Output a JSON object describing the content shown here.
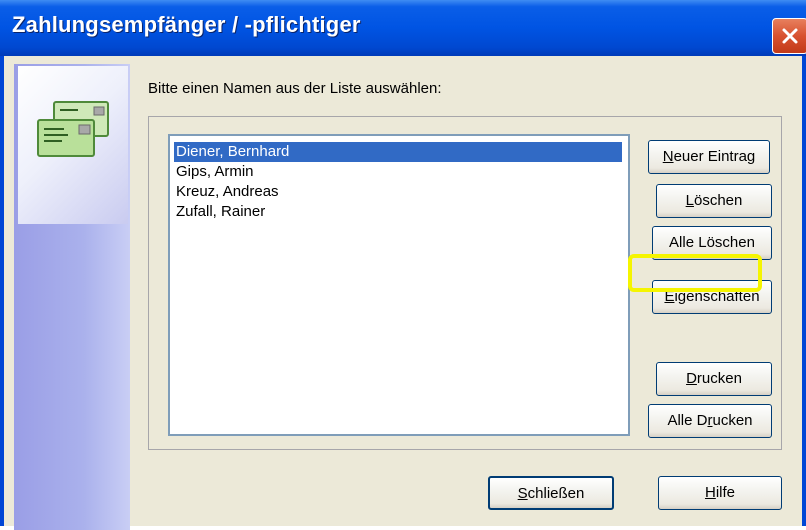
{
  "window": {
    "title": "Zahlungsempfänger / -pflichtiger",
    "close_icon": "close-icon"
  },
  "dialog": {
    "prompt": "Bitte einen Namen aus der Liste auswählen:",
    "side_icon": "envelope-stack-icon",
    "list": {
      "items": [
        "Diener, Bernhard",
        "Gips, Armin",
        "Kreuz, Andreas",
        "Zufall, Rainer"
      ],
      "selected_index": 0
    },
    "buttons": {
      "neuer_eintrag": {
        "mnemonic": "N",
        "rest": "euer Eintrag"
      },
      "loeschen": {
        "mnemonic": "L",
        "rest": "öschen"
      },
      "alle_loeschen": {
        "label": "Alle Löschen"
      },
      "eigenschaften": {
        "mnemonic": "E",
        "rest": "igenschaften"
      },
      "drucken": {
        "mnemonic": "D",
        "rest": "rucken"
      },
      "alle_drucken": {
        "pre": "Alle D",
        "mnemonic": "r",
        "rest": "ucken"
      }
    },
    "footer": {
      "schliessen": {
        "mnemonic": "S",
        "rest": "chließen"
      },
      "hilfe": {
        "mnemonic": "H",
        "rest": "ilfe"
      }
    }
  },
  "annotation": {
    "highlight_color": "#f5f500"
  }
}
